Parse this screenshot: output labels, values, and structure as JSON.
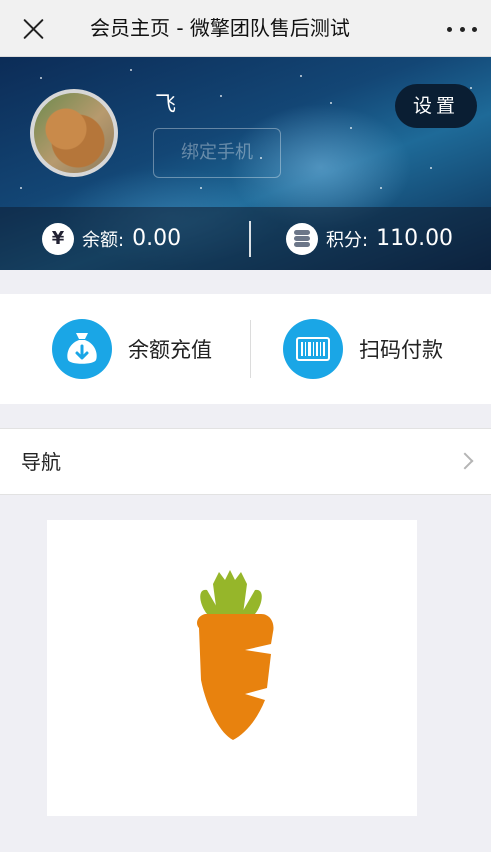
{
  "navbar": {
    "title": "会员主页 - 微擎团队售后测试"
  },
  "profile": {
    "username": "飞",
    "bind_phone_label": "绑定手机",
    "settings_label": "设置"
  },
  "stats": {
    "balance_label": "余额:",
    "balance_value": "0.00",
    "balance_icon": "yen-icon",
    "points_label": "积分:",
    "points_value": "110.00",
    "points_icon": "coins-icon"
  },
  "actions": [
    {
      "label": "余额充值",
      "icon": "money-bag-icon"
    },
    {
      "label": "扫码付款",
      "icon": "barcode-icon"
    }
  ],
  "nav_row": {
    "label": "导航"
  },
  "colors": {
    "action_icon_bg": "#1aa6e6",
    "carrot_body": "#e8820e",
    "carrot_leaves": "#96b62a"
  }
}
